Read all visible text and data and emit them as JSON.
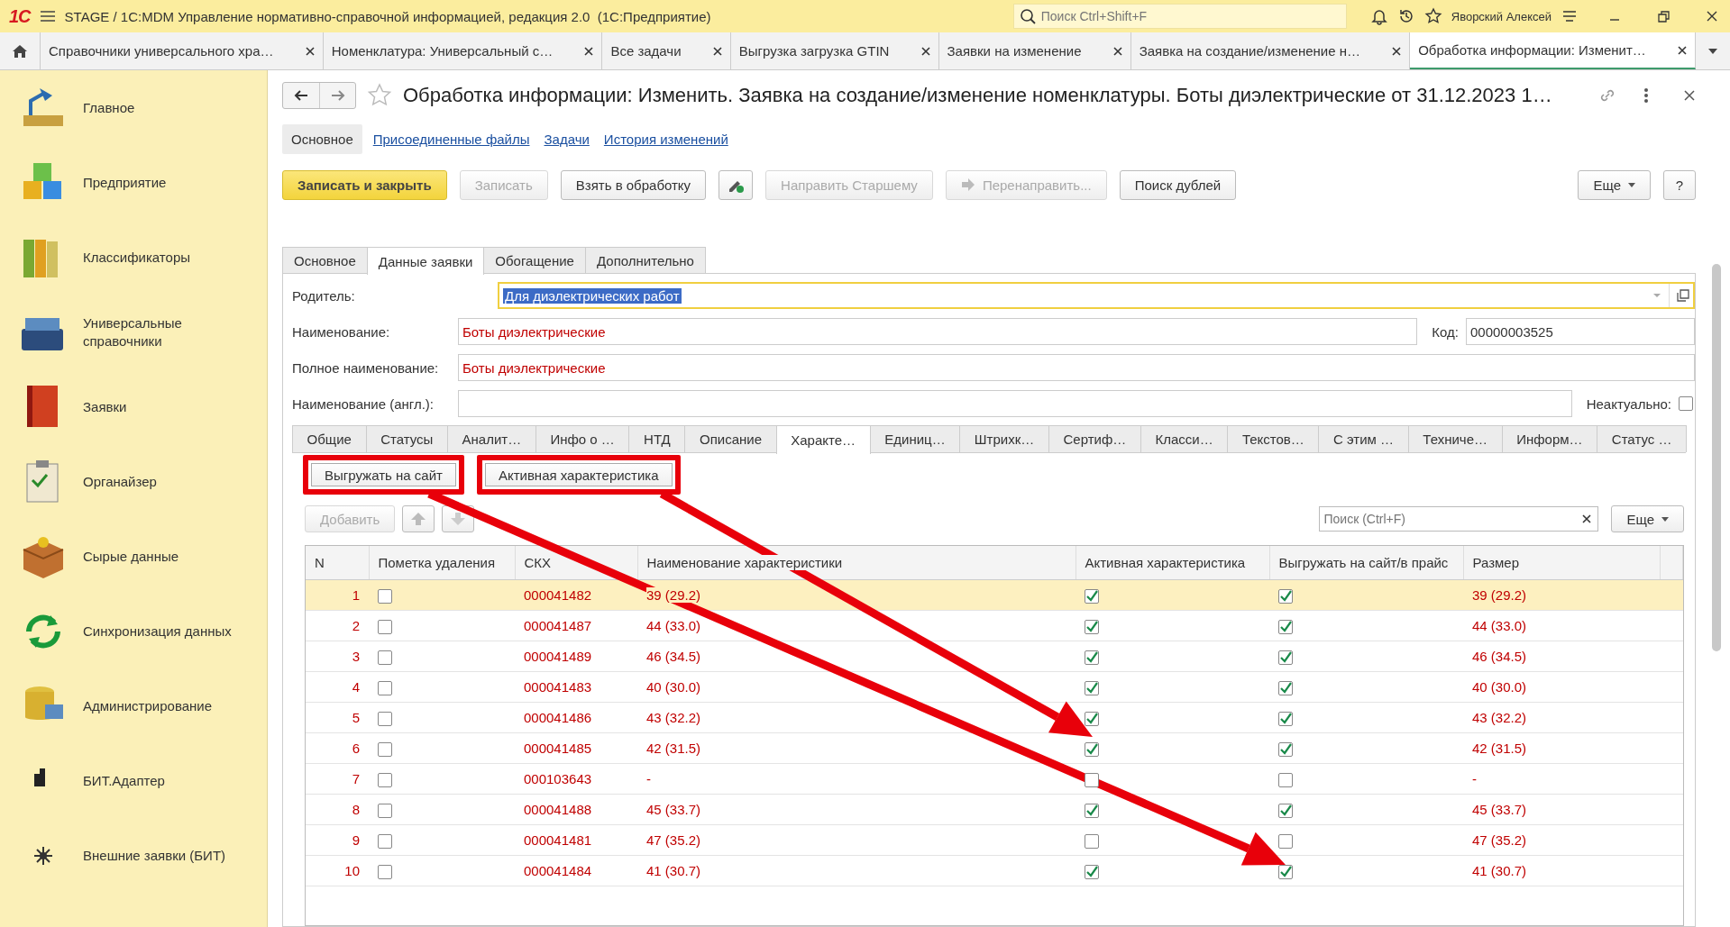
{
  "app": {
    "logo": "1С",
    "title": "STAGE / 1C:MDM Управление нормативно-справочной информацией, редакция 2.0  (1С:Предприятие)",
    "search_placeholder": "Поиск Ctrl+Shift+F",
    "user": "Яворский Алексей"
  },
  "open_tabs": [
    {
      "label": "Справочники универсального хра…",
      "selected": false
    },
    {
      "label": "Номенклатура: Универсальный с…",
      "selected": false
    },
    {
      "label": "Все задачи",
      "selected": false
    },
    {
      "label": "Выгрузка загрузка GTIN",
      "selected": false
    },
    {
      "label": "Заявки на изменение",
      "selected": false
    },
    {
      "label": "Заявка на создание/изменение н…",
      "selected": false
    },
    {
      "label": "Обработка информации: Изменит…",
      "selected": true
    }
  ],
  "sidebar": {
    "items": [
      {
        "label": "Главное"
      },
      {
        "label": "Предприятие"
      },
      {
        "label": "Классификаторы"
      },
      {
        "label": "Универсальные справочники"
      },
      {
        "label": "Заявки"
      },
      {
        "label": "Органайзер"
      },
      {
        "label": "Сырые данные"
      },
      {
        "label": "Синхронизация данных"
      },
      {
        "label": "Администрирование"
      },
      {
        "label": "БИТ.Адаптер"
      },
      {
        "label": "Внешние заявки (БИТ)"
      }
    ]
  },
  "form": {
    "title": "Обработка информации: Изменить. Заявка на создание/изменение номенклатуры. Боты диэлектрические от 31.12.2023 1…",
    "nav": [
      {
        "label": "Основное",
        "selected": true
      },
      {
        "label": "Присоединенные файлы",
        "selected": false
      },
      {
        "label": "Задачи",
        "selected": false
      },
      {
        "label": "История изменений",
        "selected": false
      }
    ],
    "toolbar": [
      {
        "kind": "primary",
        "label": "Записать и закрыть",
        "disabled": false
      },
      {
        "kind": "text",
        "label": "Записать",
        "disabled": true
      },
      {
        "kind": "text",
        "label": "Взять в обработку",
        "disabled": false
      },
      {
        "kind": "icon",
        "disabled": false
      },
      {
        "kind": "text",
        "label": "Направить Старшему",
        "disabled": true
      },
      {
        "kind": "icon-text",
        "label": "Перенаправить...",
        "disabled": true
      },
      {
        "kind": "text",
        "label": "Поиск дублей",
        "disabled": false
      }
    ],
    "more_button": "Еще",
    "help_button": "?",
    "tabs": [
      {
        "label": "Основное",
        "selected": false
      },
      {
        "label": "Данные заявки",
        "selected": true
      },
      {
        "label": "Обогащение",
        "selected": false
      },
      {
        "label": "Дополнительно",
        "selected": false
      }
    ],
    "fields": [
      {
        "kind": "select",
        "label": "Родитель:",
        "value": "Для диэлектрических работ",
        "focused": true
      },
      {
        "kind": "text-code",
        "label": "Наименование:",
        "value": "Боты диэлектрические",
        "focused": false,
        "changed": true,
        "side_label": "Код:",
        "side_value": "00000003525"
      },
      {
        "kind": "text",
        "label": "Полное наименование:",
        "value": "Боты диэлектрические",
        "focused": false,
        "changed": true
      },
      {
        "kind": "text-check",
        "label": "Наименование (англ.):",
        "focused": false,
        "side_label": "Неактуально:",
        "side_checked": false
      }
    ],
    "inner_tabs": [
      {
        "label": "Общие",
        "selected": false
      },
      {
        "label": "Статусы",
        "selected": false
      },
      {
        "label": "Аналит…",
        "selected": false
      },
      {
        "label": "Инфо о …",
        "selected": false
      },
      {
        "label": "НТД",
        "selected": false
      },
      {
        "label": "Описание",
        "selected": false
      },
      {
        "label": "Характе…",
        "selected": true
      },
      {
        "label": "Единиц…",
        "selected": false
      },
      {
        "label": "Штрихк…",
        "selected": false
      },
      {
        "label": "Сертиф…",
        "selected": false
      },
      {
        "label": "Класси…",
        "selected": false
      },
      {
        "label": "Текстов…",
        "selected": false
      },
      {
        "label": "С этим …",
        "selected": false
      },
      {
        "label": "Техниче…",
        "selected": false
      },
      {
        "label": "Информ…",
        "selected": false
      },
      {
        "label": "Статус …",
        "selected": false
      }
    ],
    "sub_buttons": [
      {
        "label": "Выгружать на сайт",
        "highlighted": true
      },
      {
        "label": "Активная характеристика",
        "highlighted": true
      }
    ],
    "table_toolbar": {
      "add": "Добавить",
      "add_disabled": true,
      "search_placeholder": "Поиск (Ctrl+F)",
      "more": "Еще"
    },
    "table": {
      "columns": [
        "N",
        "Пометка удаления",
        "СКХ",
        "Наименование характеристики",
        "Активная характеристика",
        "Выгружать на сайт/в прайс",
        "Размер"
      ],
      "rows": [
        {
          "n": "1",
          "deleted": false,
          "code": "000041482",
          "name": "39 (29.2)",
          "active": true,
          "export": true,
          "size": "39 (29.2)",
          "selected": true
        },
        {
          "n": "2",
          "deleted": false,
          "code": "000041487",
          "name": "44 (33.0)",
          "active": true,
          "export": true,
          "size": "44 (33.0)",
          "selected": false
        },
        {
          "n": "3",
          "deleted": false,
          "code": "000041489",
          "name": "46 (34.5)",
          "active": true,
          "export": true,
          "size": "46 (34.5)",
          "selected": false
        },
        {
          "n": "4",
          "deleted": false,
          "code": "000041483",
          "name": "40 (30.0)",
          "active": true,
          "export": true,
          "size": "40 (30.0)",
          "selected": false
        },
        {
          "n": "5",
          "deleted": false,
          "code": "000041486",
          "name": "43 (32.2)",
          "active": true,
          "export": true,
          "size": "43 (32.2)",
          "selected": false
        },
        {
          "n": "6",
          "deleted": false,
          "code": "000041485",
          "name": "42 (31.5)",
          "active": true,
          "export": true,
          "size": "42 (31.5)",
          "selected": false
        },
        {
          "n": "7",
          "deleted": false,
          "code": "000103643",
          "name": "-",
          "active": false,
          "export": false,
          "size": "-",
          "selected": false
        },
        {
          "n": "8",
          "deleted": false,
          "code": "000041488",
          "name": "45 (33.7)",
          "active": true,
          "export": true,
          "size": "45 (33.7)",
          "selected": false
        },
        {
          "n": "9",
          "deleted": false,
          "code": "000041481",
          "name": "47 (35.2)",
          "active": false,
          "export": false,
          "size": "47 (35.2)",
          "selected": false
        },
        {
          "n": "10",
          "deleted": false,
          "code": "000041484",
          "name": "41 (30.7)",
          "active": true,
          "export": true,
          "size": "41 (30.7)",
          "selected": false
        }
      ]
    }
  }
}
